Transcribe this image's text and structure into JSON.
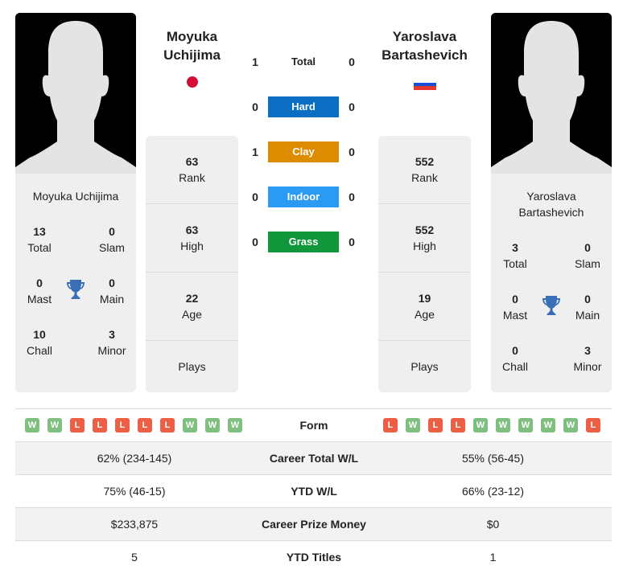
{
  "colors": {
    "hard": "#0b6ec3",
    "clay": "#dd8b00",
    "indoor": "#2b9af3",
    "grass": "#10973b",
    "win": "#7fbf7f",
    "loss": "#ec5f45",
    "trophy": "#3a6fb7"
  },
  "player1": {
    "name_line1": "Moyuka",
    "name_line2": "Uchijima",
    "card_name": "Moyuka Uchijima",
    "flag": "japan-flag",
    "titles": {
      "total": {
        "value": "13",
        "label": "Total"
      },
      "slam": {
        "value": "0",
        "label": "Slam"
      },
      "mast": {
        "value": "0",
        "label": "Mast"
      },
      "main": {
        "value": "0",
        "label": "Main"
      },
      "chall": {
        "value": "10",
        "label": "Chall"
      },
      "minor": {
        "value": "3",
        "label": "Minor"
      }
    },
    "stats": {
      "rank": {
        "value": "63",
        "label": "Rank"
      },
      "high": {
        "value": "63",
        "label": "High"
      },
      "age": {
        "value": "22",
        "label": "Age"
      },
      "plays": {
        "value": "",
        "label": "Plays"
      }
    }
  },
  "player2": {
    "name_line1": "Yaroslava",
    "name_line2": "Bartashevich",
    "card_name_line1": "Yaroslava",
    "card_name_line2": "Bartashevich",
    "flag": "russia-flag",
    "titles": {
      "total": {
        "value": "3",
        "label": "Total"
      },
      "slam": {
        "value": "0",
        "label": "Slam"
      },
      "mast": {
        "value": "0",
        "label": "Mast"
      },
      "main": {
        "value": "0",
        "label": "Main"
      },
      "chall": {
        "value": "0",
        "label": "Chall"
      },
      "minor": {
        "value": "3",
        "label": "Minor"
      }
    },
    "stats": {
      "rank": {
        "value": "552",
        "label": "Rank"
      },
      "high": {
        "value": "552",
        "label": "High"
      },
      "age": {
        "value": "19",
        "label": "Age"
      },
      "plays": {
        "value": "",
        "label": "Plays"
      }
    }
  },
  "h2h": [
    {
      "label": "Total",
      "p1": "1",
      "p2": "0",
      "kind": "total"
    },
    {
      "label": "Hard",
      "p1": "0",
      "p2": "0",
      "kind": "hard"
    },
    {
      "label": "Clay",
      "p1": "1",
      "p2": "0",
      "kind": "clay"
    },
    {
      "label": "Indoor",
      "p1": "0",
      "p2": "0",
      "kind": "indoor"
    },
    {
      "label": "Grass",
      "p1": "0",
      "p2": "0",
      "kind": "grass"
    }
  ],
  "table": {
    "form": {
      "label": "Form",
      "p1": [
        "W",
        "W",
        "L",
        "L",
        "L",
        "L",
        "L",
        "W",
        "W",
        "W"
      ],
      "p2": [
        "L",
        "W",
        "L",
        "L",
        "W",
        "W",
        "W",
        "W",
        "W",
        "L"
      ]
    },
    "rows": [
      {
        "label": "Career Total W/L",
        "p1": "62% (234-145)",
        "p2": "55% (56-45)"
      },
      {
        "label": "YTD W/L",
        "p1": "75% (46-15)",
        "p2": "66% (23-12)"
      },
      {
        "label": "Career Prize Money",
        "p1": "$233,875",
        "p2": "$0"
      },
      {
        "label": "YTD Titles",
        "p1": "5",
        "p2": "1"
      }
    ]
  }
}
